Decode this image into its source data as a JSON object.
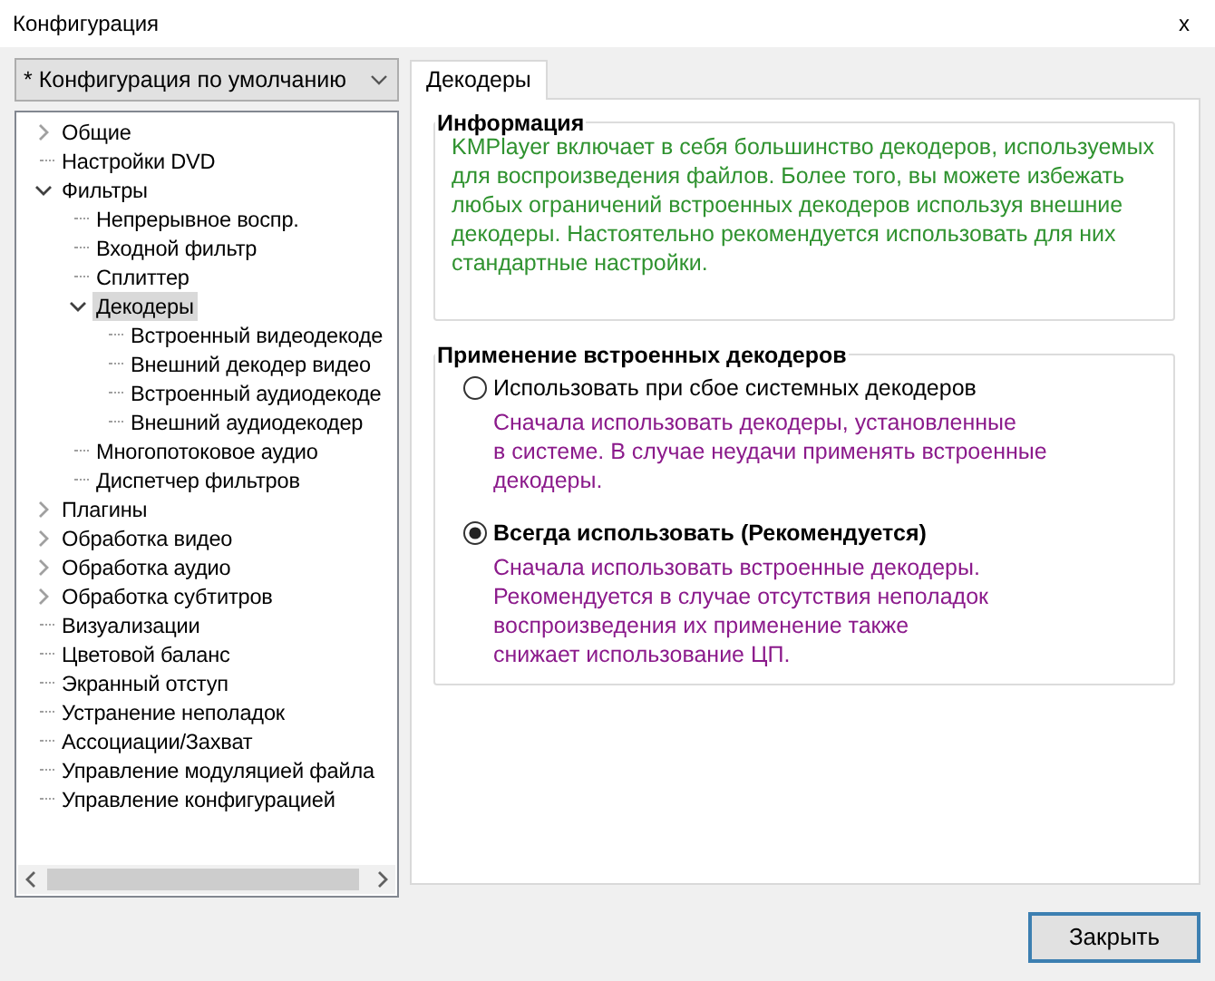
{
  "window": {
    "title": "Конфигурация",
    "close": "x"
  },
  "profile": {
    "value": "* Конфигурация по умолчанию"
  },
  "tree": [
    {
      "label": "Общие",
      "expanded": false,
      "selected": false
    },
    {
      "label": "Настройки DVD",
      "selected": false
    },
    {
      "label": "Фильтры",
      "expanded": true,
      "selected": false,
      "children": [
        {
          "label": "Непрерывное воспр.",
          "selected": false
        },
        {
          "label": "Входной фильтр",
          "selected": false
        },
        {
          "label": "Сплиттер",
          "selected": false
        },
        {
          "label": "Декодеры",
          "expanded": true,
          "selected": true,
          "children": [
            {
              "label": "Встроенный видеодекоде",
              "selected": false
            },
            {
              "label": "Внешний декодер видео",
              "selected": false
            },
            {
              "label": "Встроенный аудиодекоде",
              "selected": false
            },
            {
              "label": "Внешний аудиодекодер",
              "selected": false
            }
          ]
        },
        {
          "label": "Многопотоковое аудио",
          "selected": false
        },
        {
          "label": "Диспетчер фильтров",
          "selected": false
        }
      ]
    },
    {
      "label": "Плагины",
      "expanded": false,
      "selected": false
    },
    {
      "label": "Обработка видео",
      "expanded": false,
      "selected": false
    },
    {
      "label": "Обработка аудио",
      "expanded": false,
      "selected": false
    },
    {
      "label": "Обработка субтитров",
      "expanded": false,
      "selected": false
    },
    {
      "label": "Визуализации",
      "selected": false
    },
    {
      "label": "Цветовой баланс",
      "selected": false
    },
    {
      "label": "Экранный отступ",
      "selected": false
    },
    {
      "label": "Устранение неполадок",
      "selected": false
    },
    {
      "label": "Ассоциации/Захват",
      "selected": false
    },
    {
      "label": "Управление модуляцией файла",
      "selected": false
    },
    {
      "label": "Управление конфигурацией",
      "selected": false
    }
  ],
  "tabs": [
    {
      "label": "Декодеры",
      "selected": true
    }
  ],
  "info": {
    "title": "Информация",
    "text": "KMPlayer включает в себя большинство декодеров, используемых для воспроизведения файлов. Более того, вы можете избежать любых ограничений встроенных декодеров используя внешние декодеры. Настоятельно рекомендуется использовать для них стандартные настройки."
  },
  "decoder_usage": {
    "title": "Применение встроенных декодеров",
    "options": [
      {
        "label": "Использовать при сбое системных декодеров",
        "selected": false,
        "description": [
          "Сначала использовать декодеры, установленные",
          "в системе. В случае неудачи применять встроенные",
          "декодеры."
        ]
      },
      {
        "label": "Всегда использовать (Рекомендуется)",
        "selected": true,
        "description": [
          "Сначала использовать встроенные декодеры.",
          "Рекомендуется в случае отсутствия неполадок",
          "воспроизведения их применение также",
          "снижает использование ЦП."
        ]
      }
    ]
  },
  "buttons": [
    {
      "label": "Закрыть"
    }
  ]
}
